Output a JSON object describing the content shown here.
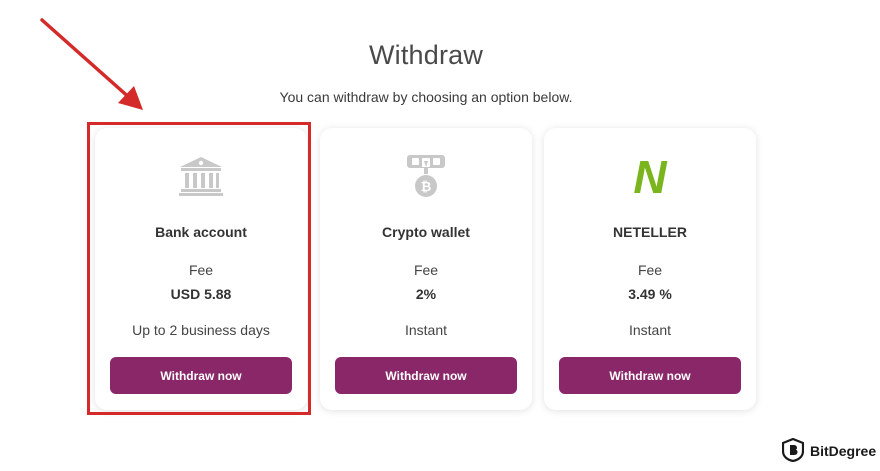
{
  "page": {
    "title": "Withdraw",
    "subtitle": "You can withdraw by choosing an option below."
  },
  "colors": {
    "button_bg": "#8a2768",
    "highlight": "#d42a2a",
    "neteller_green": "#7ab51d",
    "icon_gray": "#c8c8c8"
  },
  "options": [
    {
      "name": "Bank account",
      "icon": "bank-icon",
      "fee_label": "Fee",
      "fee_value": "USD 5.88",
      "timing": "Up to 2 business days",
      "button_label": "Withdraw now"
    },
    {
      "name": "Crypto wallet",
      "icon": "crypto-wallet-icon",
      "fee_label": "Fee",
      "fee_value": "2%",
      "timing": "Instant",
      "button_label": "Withdraw now"
    },
    {
      "name": "NETELLER",
      "icon": "neteller-logo-icon",
      "icon_text": "N",
      "fee_label": "Fee",
      "fee_value": "3.49 %",
      "timing": "Instant",
      "button_label": "Withdraw now"
    }
  ],
  "watermark": {
    "text": "BitDegree",
    "icon": "bitdegree-logo-icon"
  }
}
